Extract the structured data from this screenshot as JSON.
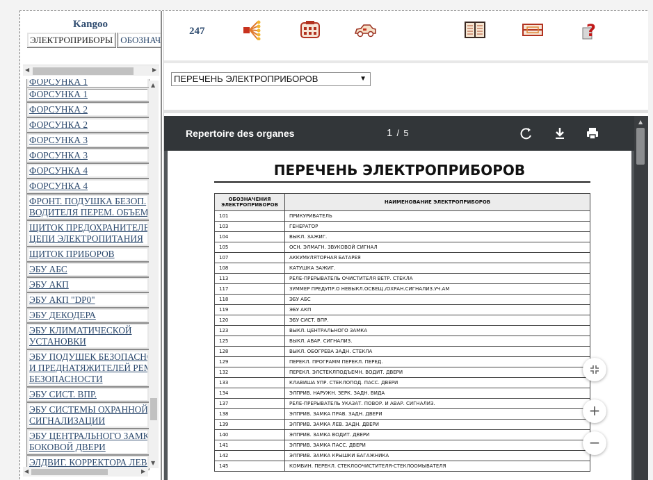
{
  "sidebar": {
    "title": "Kangoo",
    "tabs": [
      "ЭЛЕКТРОПРИБОРЫ",
      "ОБОЗНАЧЕ"
    ],
    "items": [
      {
        "line1": "ФОРСУНКА 1",
        "line2": ""
      },
      {
        "line1": "ФОРСУНКА 1",
        "line2": ""
      },
      {
        "line1": "ФОРСУНКА 2",
        "line2": ""
      },
      {
        "line1": "ФОРСУНКА 2",
        "line2": ""
      },
      {
        "line1": "ФОРСУНКА 3",
        "line2": ""
      },
      {
        "line1": "ФОРСУНКА 3",
        "line2": ""
      },
      {
        "line1": "ФОРСУНКА 4",
        "line2": ""
      },
      {
        "line1": "ФОРСУНКА 4",
        "line2": ""
      },
      {
        "line1": "ФРОНТ. ПОДУШКА БЕЗОП.",
        "line2": "ВОДИТЕЛЯ ПЕРЕМ. ОБЪЕМА"
      },
      {
        "line1": "ЩИТОК ПРЕДОХРАНИТЕЛЕЙ",
        "line2": "ЦЕПИ ЭЛЕКТРОПИТАНИЯ"
      },
      {
        "line1": "ЩИТОК ПРИБОРОВ",
        "line2": ""
      },
      {
        "line1": "ЭБУ АБС",
        "line2": ""
      },
      {
        "line1": "ЭБУ АКП",
        "line2": ""
      },
      {
        "line1": "ЭБУ АКП \"DP0\"",
        "line2": ""
      },
      {
        "line1": "ЭБУ ДЕКОДЕРА",
        "line2": ""
      },
      {
        "line1": "ЭБУ КЛИМАТИЧЕСКОЙ",
        "line2": "УСТАНОВКИ"
      },
      {
        "line1": "ЭБУ ПОДУШЕК БЕЗОПАСНОСТИ",
        "line2": "И ПРЕДНАТЯЖИТЕЛЕЙ РЕМНЕЙ",
        "line3": "БЕЗОПАСНОСТИ"
      },
      {
        "line1": "ЭБУ СИСТ. ВПР.",
        "line2": ""
      },
      {
        "line1": "ЭБУ СИСТЕМЫ ОХРАННОЙ",
        "line2": "СИГНАЛИЗАЦИИ"
      },
      {
        "line1": "ЭБУ ЦЕНТРАЛЬНОГО ЗАМКА",
        "line2": "БОКОВОЙ ДВЕРИ"
      },
      {
        "line1": "ЭЛДВИГ. КОРРЕКТОРА ЛЕВ.",
        "line2": ""
      }
    ]
  },
  "toolbar": {
    "page_number": "247",
    "icons": [
      "wiring-diagram-icon",
      "connector-icon",
      "car-icon",
      "book-icon",
      "fuse-icon",
      "help-icon"
    ]
  },
  "selector": {
    "value": "ПЕРЕЧЕНЬ ЭЛЕКТРОПРИБОРОВ"
  },
  "viewer": {
    "title": "Repertoire des organes",
    "page_current": "1",
    "page_sep": "/",
    "page_total": "5",
    "colors": {
      "bar": "#323639",
      "background": "#525659"
    }
  },
  "document": {
    "title": "ПЕРЕЧЕНЬ ЭЛЕКТРОПРИБОРОВ",
    "col1_header": "ОБОЗНАЧЕНИЯ ЭЛЕКТРОПРИБОРОВ",
    "col2_header": "НАИМЕНОВАНИЕ ЭЛЕКТРОПРИБОРОВ",
    "rows": [
      [
        "101",
        "ПРИКУРИВАТЕЛЬ"
      ],
      [
        "103",
        "ГЕНЕРАТОР"
      ],
      [
        "104",
        "ВЫКЛ. ЗАЖИГ."
      ],
      [
        "105",
        "ОСН. ЭЛМАГН. ЗВУКОВОЙ СИГНАЛ"
      ],
      [
        "107",
        "АККУМУЛЯТОРНАЯ БАТАРЕЯ"
      ],
      [
        "108",
        "КАТУШКА ЗАЖИГ."
      ],
      [
        "113",
        "РЕЛЕ-ПРЕРЫВАТЕЛЬ ОЧИСТИТЕЛЯ ВЕТР. СТЕКЛА"
      ],
      [
        "117",
        "ЗУММЕР ПРЕДУПР.О НЕВЫКЛ.ОСВЕЩ./ОХРАН.СИГНАЛИЗ.УЧ.АМ"
      ],
      [
        "118",
        "ЭБУ АБС"
      ],
      [
        "119",
        "ЭБУ АКП"
      ],
      [
        "120",
        "ЭБУ СИСТ. ВПР."
      ],
      [
        "123",
        "ВЫКЛ. ЦЕНТРАЛЬНОГО ЗАМКА"
      ],
      [
        "125",
        "ВЫКЛ. АВАР. СИГНАЛИЗ."
      ],
      [
        "128",
        "ВЫКЛ. ОБОГРЕВА ЗАДН. СТЕКЛА"
      ],
      [
        "129",
        "ПЕРЕКЛ. ПРОГРАММ ПЕРЕКЛ. ПЕРЕД."
      ],
      [
        "132",
        "ПЕРЕКЛ. ЭЛСТЕКЛПОДЪЕМН. ВОДИТ. ДВЕРИ"
      ],
      [
        "133",
        "КЛАВИША УПР. СТЕКЛОПОД. ПАСС. ДВЕРИ"
      ],
      [
        "134",
        "ЭЛПРИВ. НАРУЖН. ЗЕРК. ЗАДН. ВИДА"
      ],
      [
        "137",
        "РЕЛЕ-ПРЕРЫВАТЕЛЬ УКАЗАТ. ПОВОР. И АВАР. СИГНАЛИЗ."
      ],
      [
        "138",
        "ЭЛПРИВ. ЗАМКА ПРАВ. ЗАДН. ДВЕРИ"
      ],
      [
        "139",
        "ЭЛПРИВ. ЗАМКА ЛЕВ. ЗАДН. ДВЕРИ"
      ],
      [
        "140",
        "ЭЛПРИВ. ЗАМКА ВОДИТ. ДВЕРИ"
      ],
      [
        "141",
        "ЭЛПРИВ. ЗАМКА ПАСС. ДВЕРИ"
      ],
      [
        "142",
        "ЭЛПРИВ. ЗАМКА КРЫШКИ БАГАЖНИКА"
      ],
      [
        "145",
        "КОМБИН. ПЕРЕКЛ. СТЕКЛООЧИСТИТЕЛЯ-СТЕКЛООМЫВАТЕЛЯ"
      ]
    ]
  },
  "fabs": {
    "fit": "fit-page-icon",
    "zoom_in": "+",
    "zoom_out": "−"
  }
}
